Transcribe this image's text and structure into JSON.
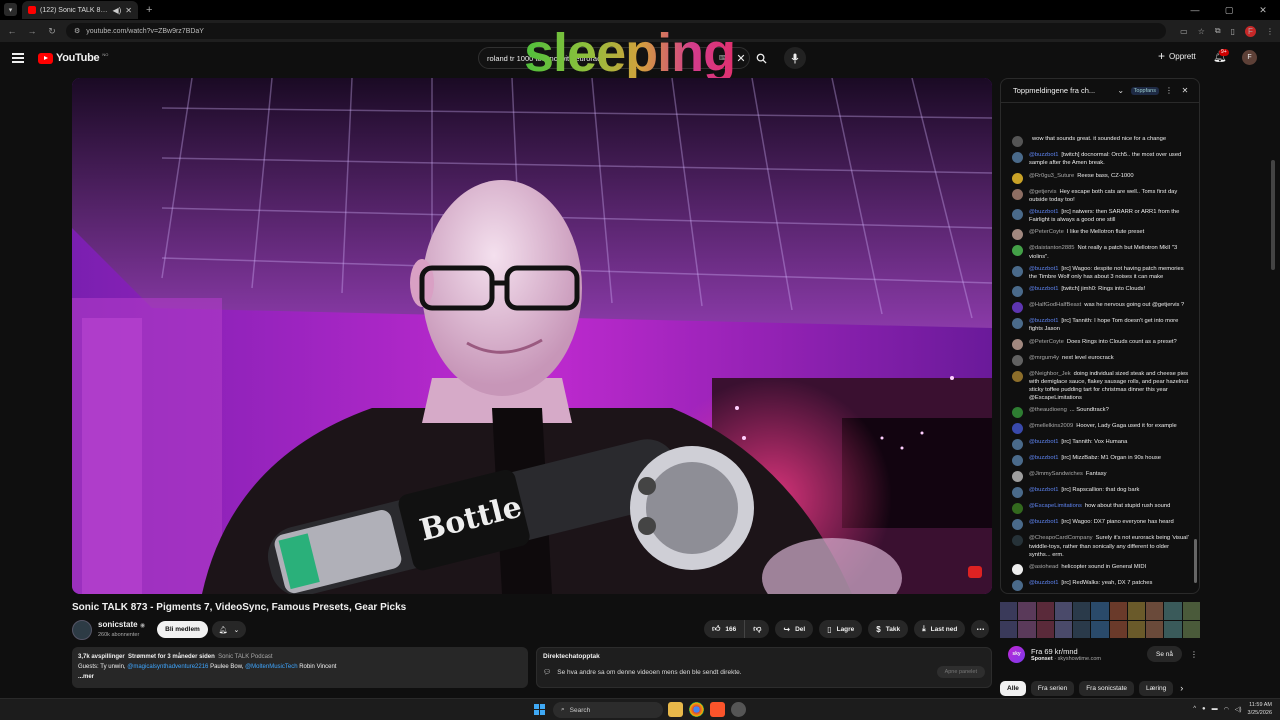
{
  "browser": {
    "tab_title": "(122) Sonic TALK 873 - Pigm",
    "url": "youtube.com/watch?v=ZBw9rz7BDaY",
    "profile_initial": "F"
  },
  "header": {
    "logo_text": "YouTube",
    "logo_cc": "NO",
    "search_value": "roland tr 1000 techno with eurorack",
    "overlay_word": "sleeping",
    "create_label": "Opprett",
    "notif_count": "9+",
    "avatar_initial": "F"
  },
  "video": {
    "title": "Sonic TALK 873 - Pigments 7, VideoSync, Famous Presets, Gear Picks",
    "channel_name": "sonicstate",
    "channel_subs": "260k abonnenter",
    "join_label": "Bli medlem",
    "like_count": "166",
    "share_label": "Del",
    "save_label": "Lagre",
    "thanks_label": "Takk",
    "download_label": "Last ned"
  },
  "description": {
    "stats": "3,7k avspillinger",
    "streamed": "Strømmet for 3 måneder siden",
    "podcast": "Sonic TALK Podcast",
    "guests_prefix": "Guests: Ty unwin,",
    "guest_link1": "@magicalsynthadventure2216",
    "guest_mid": "Paulee Bow,",
    "guest_link2": "@MoltenMusicTech",
    "guest_end": "Robin Vincent",
    "more": "...mer"
  },
  "live_chat_replay": {
    "title": "Direktechatopptak",
    "text": "Se hva andre sa om denne videoen mens den ble sendt direkte.",
    "button": "Apne panelet"
  },
  "chat": {
    "header_title": "Toppmeldingene fra ch...",
    "fans_chip": "Toppfans",
    "messages": [
      {
        "author": "",
        "text": "wow that sounds great. it sounded nice for a change",
        "color": "#555555",
        "bot": false
      },
      {
        "author": "@buzzbot1",
        "text": "[twitch] docnormal: Orch5.. the most over used sample after the Amen break.",
        "color": "#4a6a8a",
        "bot": true
      },
      {
        "author": "@Rr0gu3_Suture",
        "text": "Reese bass, CZ-1000",
        "color": "#c9a227",
        "bot": false
      },
      {
        "author": "@getjervis",
        "text": "Hey escape both cats are well.. Toms first day outside today too!",
        "color": "#8d6e63",
        "bot": false
      },
      {
        "author": "@buzzbot1",
        "text": "[irc] natwers: then SARARR or ARR1 from the Fairlight is always a good one still",
        "color": "#4a6a8a",
        "bot": true
      },
      {
        "author": "@PeterCoyte",
        "text": "I like the Mellotron flute preset",
        "color": "#a1887f",
        "bot": false
      },
      {
        "author": "@daistanton2885",
        "text": "Not really a patch but Mellotron MkII \"3 violins\".",
        "color": "#43a047",
        "bot": false
      },
      {
        "author": "@buzzbot1",
        "text": "[irc] Wagoo: despite not having patch memories the Timbre Wolf only has about 3 noises it can make",
        "color": "#4a6a8a",
        "bot": true
      },
      {
        "author": "@buzzbot1",
        "text": "[twitch] jimh0: Rings into Clouds!",
        "color": "#4a6a8a",
        "bot": true
      },
      {
        "author": "@HalfGodHalfBeast",
        "text": "was he nervous going out @getjervis ?",
        "color": "#5e35b1",
        "bot": false
      },
      {
        "author": "@buzzbot1",
        "text": "[irc] Tannith: I hope Tom doesn't get into more fights Jason",
        "color": "#4a6a8a",
        "bot": true
      },
      {
        "author": "@PeterCoyte",
        "text": "Does Rings into Clouds count as a preset?",
        "color": "#a1887f",
        "bot": false
      },
      {
        "author": "@mrgum4y",
        "text": "next level eurocrack",
        "color": "#616161",
        "bot": false
      },
      {
        "author": "@Neighbor_Jek",
        "text": "doing individual sized steak and cheese pies with demiglace sauce, flakey sausage rolls, and pear hazelnut sticky toffee pudding tart for christmas dinner this year @EscapeLimitations",
        "color": "#8d6e2a",
        "bot": false
      },
      {
        "author": "@theaudioeng",
        "text": "... Soundtrack?",
        "color": "#2e7d32",
        "bot": false
      },
      {
        "author": "@mellelkins2009",
        "text": "Hoover, Lady Gaga used it for example",
        "color": "#3949ab",
        "bot": false
      },
      {
        "author": "@buzzbot1",
        "text": "[irc] Tannith: Vox Humana",
        "color": "#4a6a8a",
        "bot": true
      },
      {
        "author": "@buzzbot1",
        "text": "[irc] MizzBabz: M1 Organ in 90s house",
        "color": "#4a6a8a",
        "bot": true
      },
      {
        "author": "@JimmySandwiches",
        "text": "Fantasy",
        "color": "#9e9e9e",
        "bot": false
      },
      {
        "author": "@buzzbot1",
        "text": "[irc] Rapscallion: that dog bark",
        "color": "#4a6a8a",
        "bot": true
      },
      {
        "author": "@EscapeLimitations",
        "text": "how about that stupid rush sound",
        "color": "#33691e",
        "bot": true
      },
      {
        "author": "@buzzbot1",
        "text": "[irc] Wagoo: DX7 piano everyone has heard",
        "color": "#4a6a8a",
        "bot": true
      },
      {
        "author": "@CheapoCardCompany",
        "text": "Surely it's not eurorack being 'visual' twiddle-toys, rather than sonically any different to older synths... erm.",
        "color": "#263238",
        "bot": false
      },
      {
        "author": "@asiohead",
        "text": "helicopter sound in General MIDI",
        "color": "#eeeeee",
        "bot": false
      },
      {
        "author": "@buzzbot1",
        "text": "[irc] RedWalks: yeah, DX 7 patches",
        "color": "#4a6a8a",
        "bot": true
      }
    ]
  },
  "ad": {
    "title": "Fra 69 kr/mnd",
    "sponsored": "Sponset",
    "domain": "skyshowtime.com",
    "logo_text": "sky",
    "button": "Se nå"
  },
  "chips": [
    "Alle",
    "Fra serien",
    "Fra sonicstate",
    "Læring"
  ],
  "taskbar": {
    "search": "Search",
    "time": "11:59 AM",
    "date": "3/25/2026"
  }
}
